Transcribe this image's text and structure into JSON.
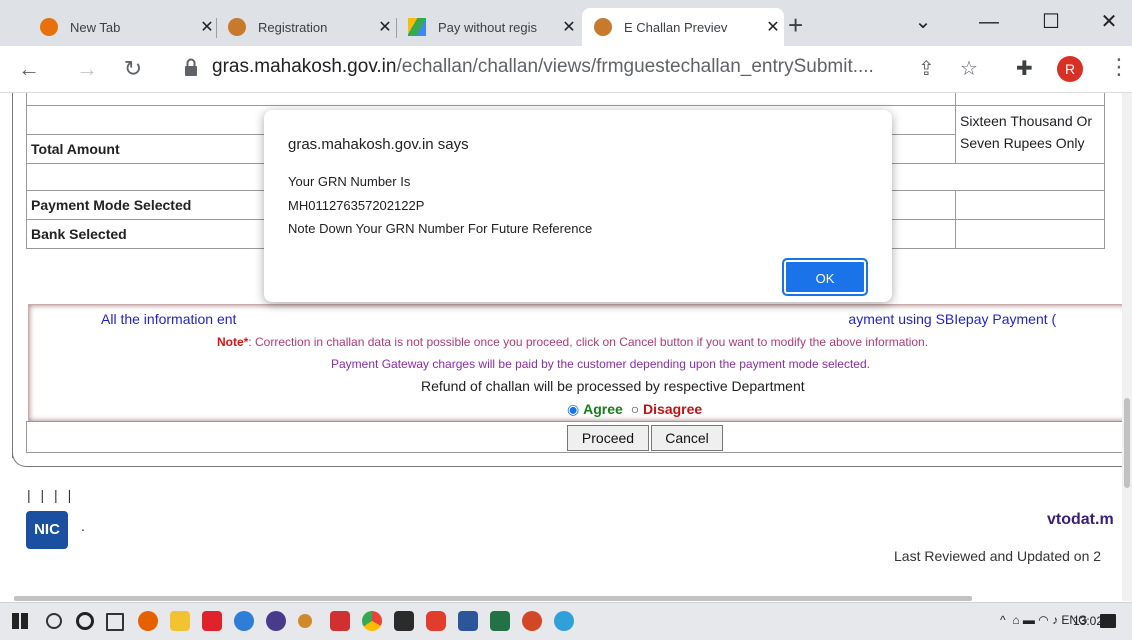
{
  "browser": {
    "tabs": [
      {
        "label": "New Tab",
        "active": false
      },
      {
        "label": "Registration",
        "active": false
      },
      {
        "label": "Pay without regis",
        "active": false
      },
      {
        "label": "E Challan Previev",
        "active": true
      }
    ],
    "url_host": "gras.mahakosh.gov.in",
    "url_path": "/echallan/challan/views/frmguestechallan_entrySubmit....",
    "avatar_letter": "R",
    "colors": {
      "tabstrip": "#dee1e6",
      "avatar": "#d93025"
    }
  },
  "form": {
    "amount_words_1": "Sixteen Thousand Or",
    "amount_words_2": "Seven Rupees Only",
    "total_amount_label": "Total Amount",
    "payment_mode_label": "Payment Mode Selected",
    "bank_label": "Bank Selected"
  },
  "info": {
    "line1_a": "All the information ent",
    "line1_b": "ayment using SBIepay Payment (",
    "note_label": "Note*",
    "note_text": ": Correction in challan data is not possible once you proceed, click on Cancel button if you want to modify the above information.",
    "gateway_text": "Payment Gateway charges will be paid by the customer depending upon the payment mode selected.",
    "refund_text": "Refund of challan will be processed by respective Department",
    "agree_label": "Agree",
    "disagree_label": "Disagree",
    "agree_selected": true
  },
  "buttons": {
    "proceed": "Proceed",
    "cancel": "Cancel"
  },
  "footer": {
    "bars": "| | | |",
    "nic_logo": "NIC",
    "dot": ".",
    "site": "vtodat.m",
    "reviewed": "Last Reviewed and Updated on 2"
  },
  "dialog": {
    "title": "gras.mahakosh.gov.in says",
    "line1": "Your GRN Number Is",
    "grn": "MH011276357202122P",
    "line3": "Note Down Your GRN Number For Future Reference",
    "ok": "OK"
  },
  "taskbar": {
    "tray_lang": "ENG",
    "time": "13:02"
  }
}
